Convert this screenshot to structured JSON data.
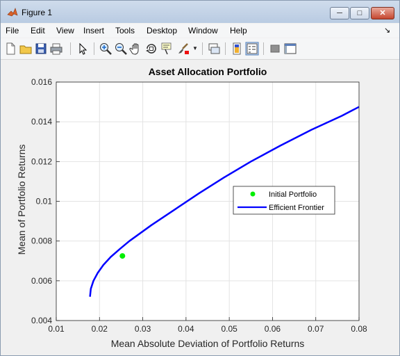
{
  "window": {
    "title": "Figure 1"
  },
  "menu": [
    "File",
    "Edit",
    "View",
    "Insert",
    "Tools",
    "Desktop",
    "Window",
    "Help"
  ],
  "toolbar": {
    "icons": [
      "new-figure-icon",
      "open-file-icon",
      "save-icon",
      "print-icon",
      "edit-plot-arrow-icon",
      "zoom-in-icon",
      "zoom-out-icon",
      "pan-hand-icon",
      "rotate-3d-icon",
      "data-cursor-icon",
      "brush-icon",
      "brush-dropdown-icon",
      "link-plot-icon",
      "insert-colorbar-icon",
      "insert-legend-icon",
      "hide-plot-tools-icon",
      "show-plot-tools-icon"
    ]
  },
  "chart_data": {
    "type": "line",
    "title": "Asset Allocation Portfolio",
    "xlabel": "Mean Absolute Deviation of Portfolio Returns",
    "ylabel": "Mean of Portfolio Returns",
    "xlim": [
      0.01,
      0.08
    ],
    "ylim": [
      0.004,
      0.016
    ],
    "xticks": [
      0.01,
      0.02,
      0.03,
      0.04,
      0.05,
      0.06,
      0.07,
      0.08
    ],
    "xtick_labels": [
      "0.01",
      "0.02",
      "0.03",
      "0.04",
      "0.05",
      "0.06",
      "0.07",
      "0.08"
    ],
    "yticks": [
      0.004,
      0.006,
      0.008,
      0.01,
      0.012,
      0.014,
      0.016
    ],
    "ytick_labels": [
      "0.004",
      "0.006",
      "0.008",
      "0.01",
      "0.012",
      "0.014",
      "0.016"
    ],
    "grid": true,
    "legend_position": "right-center",
    "series": [
      {
        "name": "Initial Portfolio",
        "kind": "scatter",
        "color": "#00ee00",
        "points": [
          [
            0.0253,
            0.00725
          ]
        ]
      },
      {
        "name": "Efficient Frontier",
        "kind": "line",
        "color": "#0000ff",
        "points": [
          [
            0.0178,
            0.0052
          ],
          [
            0.018,
            0.0056
          ],
          [
            0.0186,
            0.006
          ],
          [
            0.0196,
            0.0064
          ],
          [
            0.0209,
            0.0068
          ],
          [
            0.0226,
            0.0072
          ],
          [
            0.0247,
            0.0076
          ],
          [
            0.0269,
            0.008
          ],
          [
            0.032,
            0.0088
          ],
          [
            0.0375,
            0.0096
          ],
          [
            0.043,
            0.0104
          ],
          [
            0.0488,
            0.0112
          ],
          [
            0.055,
            0.012
          ],
          [
            0.0618,
            0.0128
          ],
          [
            0.069,
            0.0136
          ],
          [
            0.076,
            0.0143
          ],
          [
            0.08,
            0.01475
          ]
        ]
      }
    ]
  }
}
